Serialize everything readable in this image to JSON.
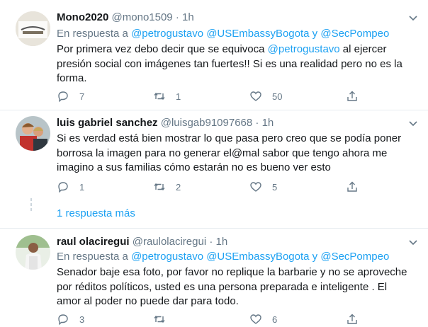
{
  "tweets": [
    {
      "name": "Mono2020",
      "handle": "@mono1509",
      "dot": "·",
      "time": "1h",
      "reply_prefix": "En respuesta a",
      "reply_mentions": [
        "@petrogustavo",
        "@USEmbassyBogota",
        "@SecPompeo"
      ],
      "reply_and": "y",
      "text_before": "Por primera vez debo decir que se equivoca ",
      "mention": "@petrogustavo",
      "text_after": "  al ejercer presión social con imágenes tan fuertes!! Si es una realidad pero no es la forma.",
      "replies": "7",
      "retweets": "1",
      "likes": "50"
    },
    {
      "name": "luis gabriel sanchez",
      "handle": "@luisgab91097668",
      "dot": "·",
      "time": "1h",
      "text": "Si es verdad está bien mostrar lo que pasa pero creo que se podía poner borrosa la imagen para no generar el@mal sabor que tengo ahora me imagino a sus familias cómo estarán no es bueno ver esto",
      "replies": "1",
      "retweets": "2",
      "likes": "5"
    },
    {
      "name": "raul olaciregui",
      "handle": "@raulolaciregui",
      "dot": "·",
      "time": "1h",
      "reply_prefix": "En respuesta a",
      "reply_mentions": [
        "@petrogustavo",
        "@USEmbassyBogota",
        "@SecPompeo"
      ],
      "reply_and": "y",
      "text": "Senador baje esa foto,  por favor no replique la barbarie y no se aproveche por réditos políticos, usted es una persona preparada e inteligente . El amor al poder no puede dar para todo.",
      "replies": "3",
      "retweets": "",
      "likes": "6"
    }
  ],
  "show_more": "1 respuesta más",
  "colors": {
    "link": "#1da1f2",
    "muted": "#657786",
    "divider": "#e6ecf0"
  }
}
